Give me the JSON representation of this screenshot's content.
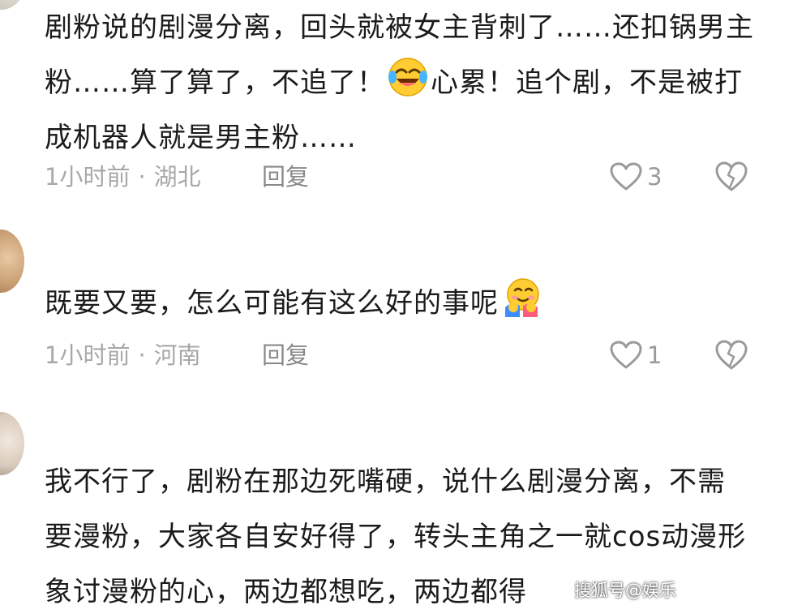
{
  "comments": [
    {
      "username": "",
      "text_parts": [
        "剧粉说的剧漫分离，回头就被女主背刺了……还扣锅男主粉……算了算了，不追了！",
        "心累！追个剧，不是被打成机器人就是男主粉……"
      ],
      "emoji": "rolling-on-floor-laughing-emoji",
      "time": "1小时前",
      "location": "湖北",
      "reply_label": "回复",
      "likes": "3"
    },
    {
      "username": "",
      "text_parts": [
        "既要又要，怎么可能有这么好的事呢"
      ],
      "emoji": "hugging-face-emoji",
      "time": "1小时前",
      "location": "河南",
      "reply_label": "回复",
      "likes": "1"
    },
    {
      "username": "",
      "text_parts": [
        "我不行了，剧粉在那边死嘴硬，说什么剧漫分离，不需要漫粉，大家各自安好得了，转头主角之一就cos动漫形象讨漫粉的心，两边都想吃，两边都得"
      ]
    }
  ],
  "separator": "·",
  "watermark": "搜狐号@娱乐"
}
